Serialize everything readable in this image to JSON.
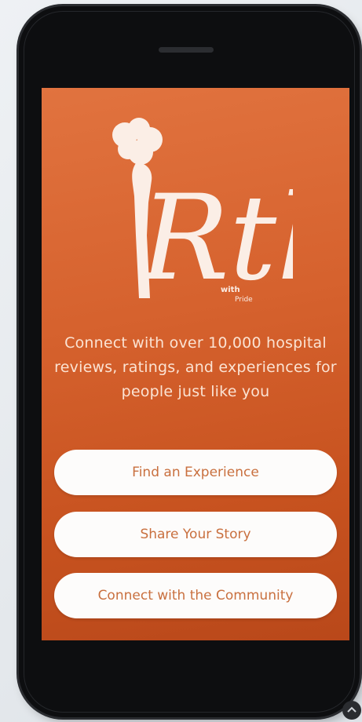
{
  "brand": {
    "logo_main": "Rth",
    "logo_sub1": "with",
    "logo_sub2": "Pride"
  },
  "tagline": "Connect with over 10,000 hospital reviews, ratings, and experiences for people just like you",
  "buttons": {
    "find": "Find an Experience",
    "share": "Share Your Story",
    "connect": "Connect with the Community"
  },
  "colors": {
    "screen_gradient_top": "#e1733f",
    "screen_gradient_bottom": "#b9481a",
    "button_text": "#c9703f",
    "button_bg": "#fdfcfb",
    "tagline_text": "#fbe3d3"
  }
}
